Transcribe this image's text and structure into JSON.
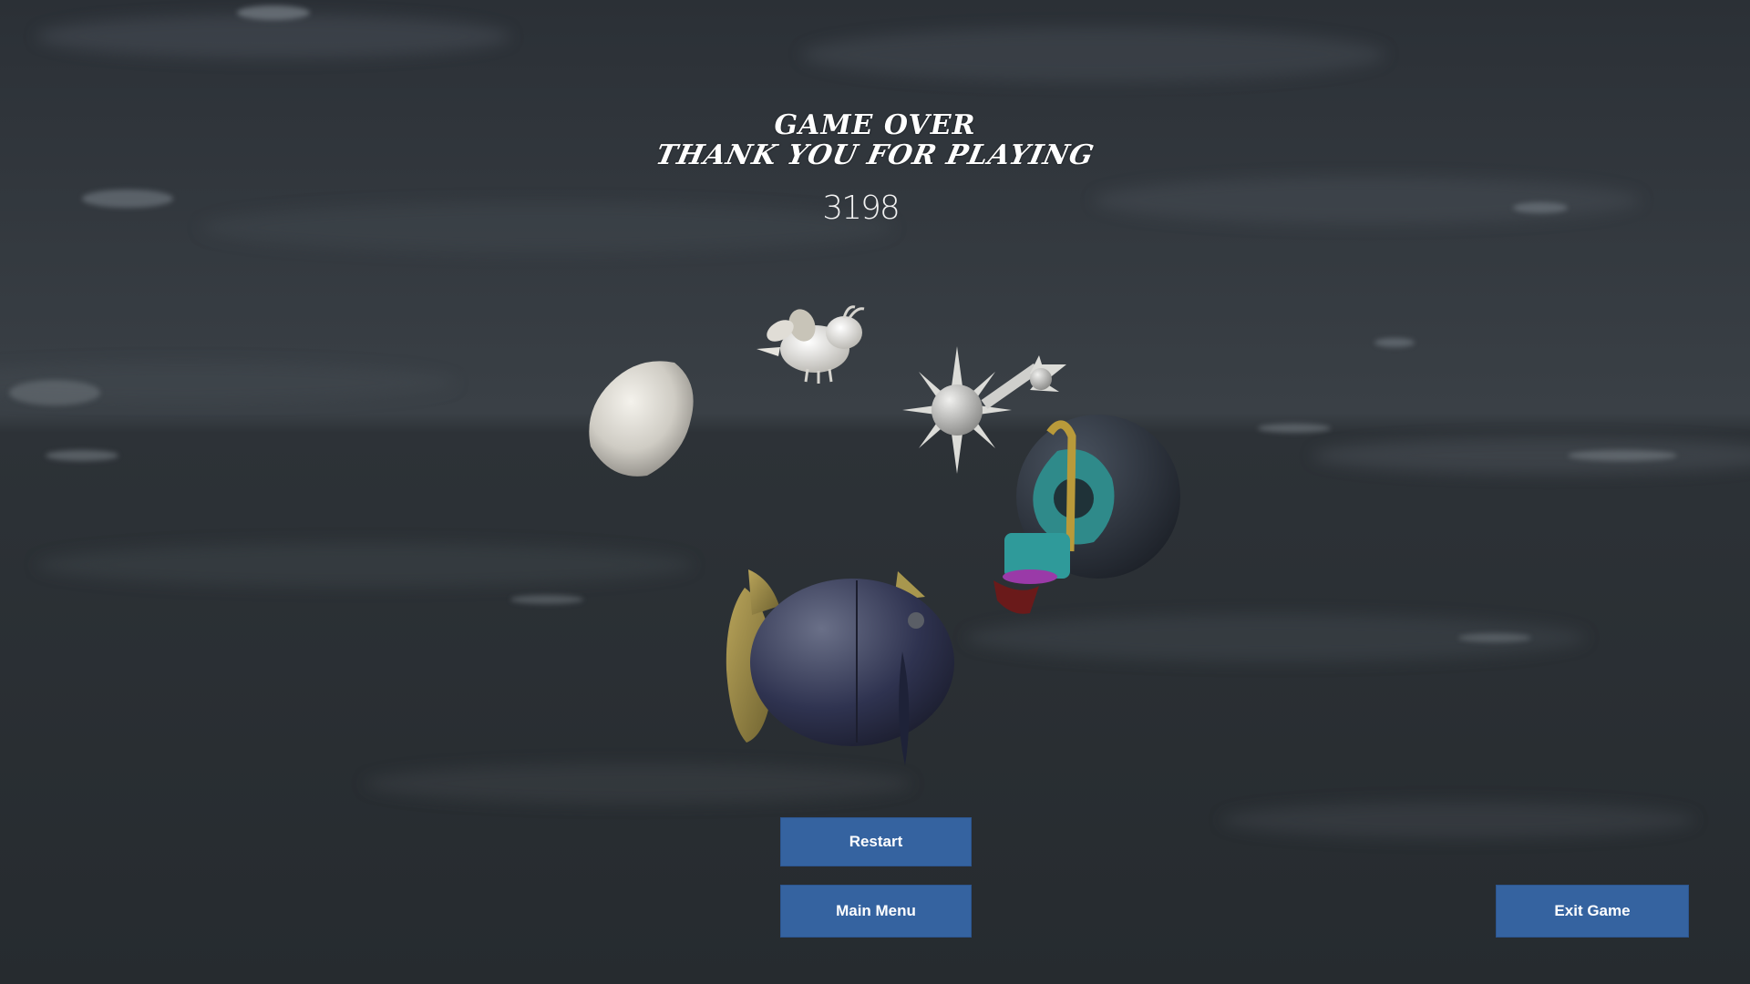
{
  "game_over": {
    "line1": "GAME OVER",
    "line2": "THANK YOU FOR PLAYING",
    "score": "3198"
  },
  "buttons": {
    "restart_label": "Restart",
    "main_menu_label": "Main Menu",
    "exit_label": "Exit Game"
  },
  "colors": {
    "button_bg": "#3563a0",
    "button_text": "#ffffff",
    "background": "#2a2f33"
  },
  "models": [
    "rock",
    "bee",
    "spiked-mace",
    "bomb-creature",
    "armored-fish"
  ]
}
